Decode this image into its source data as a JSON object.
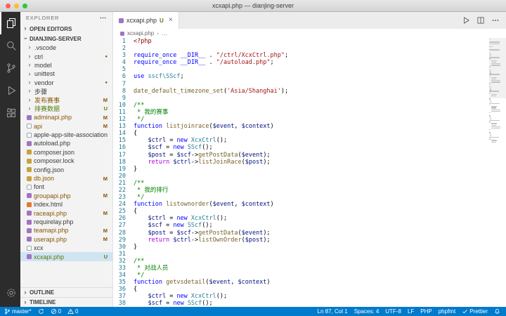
{
  "window": {
    "title": "xcxapi.php — dianjing-server"
  },
  "activity_bar": {
    "items": [
      {
        "name": "explorer",
        "active": true
      },
      {
        "name": "search"
      },
      {
        "name": "source-control"
      },
      {
        "name": "run-debug"
      },
      {
        "name": "extensions"
      },
      {
        "name": "settings",
        "bottom": true
      }
    ]
  },
  "sidebar": {
    "title": "EXPLORER",
    "open_editors_label": "OPEN EDITORS",
    "root_label": "DIANJING-SERVER",
    "outline_label": "OUTLINE",
    "timeline_label": "TIMELINE",
    "tree": [
      {
        "label": ".vscode",
        "kind": "folder",
        "badge": ""
      },
      {
        "label": "ctrl",
        "kind": "folder",
        "badge": "dot"
      },
      {
        "label": "model",
        "kind": "folder",
        "badge": ""
      },
      {
        "label": "unittest",
        "kind": "folder",
        "badge": ""
      },
      {
        "label": "vendor",
        "kind": "folder",
        "badge": "dot"
      },
      {
        "label": "步骤",
        "kind": "folder",
        "badge": ""
      },
      {
        "label": "发布赛事",
        "kind": "folder",
        "badge": "M"
      },
      {
        "label": "排赛数据",
        "kind": "folder",
        "badge": "U"
      },
      {
        "label": "adminapi.php",
        "kind": "php",
        "badge": "M"
      },
      {
        "label": "api",
        "kind": "file",
        "badge": "M"
      },
      {
        "label": "apple-app-site-association",
        "kind": "file",
        "badge": ""
      },
      {
        "label": "autoload.php",
        "kind": "php",
        "badge": ""
      },
      {
        "label": "composer.json",
        "kind": "json",
        "badge": ""
      },
      {
        "label": "composer.lock",
        "kind": "json",
        "badge": ""
      },
      {
        "label": "config.json",
        "kind": "json",
        "badge": ""
      },
      {
        "label": "db.json",
        "kind": "json",
        "badge": "M"
      },
      {
        "label": "font",
        "kind": "file",
        "badge": ""
      },
      {
        "label": "groupapi.php",
        "kind": "php",
        "badge": "M"
      },
      {
        "label": "index.html",
        "kind": "html",
        "badge": ""
      },
      {
        "label": "raceapi.php",
        "kind": "php",
        "badge": "M"
      },
      {
        "label": "requirelay.php",
        "kind": "php",
        "badge": ""
      },
      {
        "label": "teamapi.php",
        "kind": "php",
        "badge": "M"
      },
      {
        "label": "userapi.php",
        "kind": "php",
        "badge": "M"
      },
      {
        "label": "xcx",
        "kind": "file",
        "badge": ""
      },
      {
        "label": "xcxapi.php",
        "kind": "php",
        "badge": "U",
        "selected": true
      }
    ]
  },
  "editor": {
    "tab": {
      "label": "xcxapi.php",
      "badge": "U",
      "close": "×"
    },
    "actions": [
      "run",
      "split",
      "more"
    ],
    "breadcrumb": {
      "file": "xcxapi.php",
      "separator": "›",
      "more": "…"
    },
    "code": [
      [
        [
          "tag",
          "<?php"
        ]
      ],
      [],
      [
        [
          "kw",
          "require_once"
        ],
        [
          "pln",
          " "
        ],
        [
          "kw",
          "__DIR__"
        ],
        [
          "pln",
          " . "
        ],
        [
          "str",
          "\"/ctrl/XcxCtrl.php\""
        ],
        [
          "pln",
          ";"
        ]
      ],
      [
        [
          "kw",
          "require_once"
        ],
        [
          "pln",
          " "
        ],
        [
          "kw",
          "__DIR__"
        ],
        [
          "pln",
          " . "
        ],
        [
          "str",
          "\"/autoload.php\""
        ],
        [
          "pln",
          ";"
        ]
      ],
      [],
      [
        [
          "kw",
          "use"
        ],
        [
          "pln",
          " "
        ],
        [
          "cls",
          "sscf\\SScf"
        ],
        [
          "pln",
          ";"
        ]
      ],
      [],
      [
        [
          "fn",
          "date_default_timezone_set"
        ],
        [
          "pln",
          "("
        ],
        [
          "str",
          "'Asia/Shanghai'"
        ],
        [
          "pln",
          ");"
        ]
      ],
      [],
      [
        [
          "cmt",
          "/**"
        ]
      ],
      [
        [
          "cmt",
          " * 我的赛事"
        ]
      ],
      [
        [
          "cmt",
          " */"
        ]
      ],
      [
        [
          "kw",
          "function"
        ],
        [
          "pln",
          " "
        ],
        [
          "fn",
          "listjoinrace"
        ],
        [
          "pln",
          "("
        ],
        [
          "var",
          "$event"
        ],
        [
          "pln",
          ", "
        ],
        [
          "var",
          "$context"
        ],
        [
          "pln",
          ")"
        ]
      ],
      [
        [
          "pln",
          "{"
        ]
      ],
      [
        [
          "pln",
          "    "
        ],
        [
          "var",
          "$ctrl"
        ],
        [
          "pln",
          " = "
        ],
        [
          "kw",
          "new"
        ],
        [
          "pln",
          " "
        ],
        [
          "cls",
          "XcxCtrl"
        ],
        [
          "pln",
          "();"
        ]
      ],
      [
        [
          "pln",
          "    "
        ],
        [
          "var",
          "$scf"
        ],
        [
          "pln",
          " = "
        ],
        [
          "kw",
          "new"
        ],
        [
          "pln",
          " "
        ],
        [
          "cls",
          "SScf"
        ],
        [
          "pln",
          "();"
        ]
      ],
      [
        [
          "pln",
          "    "
        ],
        [
          "var",
          "$post"
        ],
        [
          "pln",
          " = "
        ],
        [
          "var",
          "$scf"
        ],
        [
          "pln",
          "->"
        ],
        [
          "fn",
          "getPostData"
        ],
        [
          "pln",
          "("
        ],
        [
          "var",
          "$event"
        ],
        [
          "pln",
          ");"
        ]
      ],
      [
        [
          "pln",
          "    "
        ],
        [
          "ctl",
          "return"
        ],
        [
          "pln",
          " "
        ],
        [
          "var",
          "$ctrl"
        ],
        [
          "pln",
          "->"
        ],
        [
          "fn",
          "listJoinRace"
        ],
        [
          "pln",
          "("
        ],
        [
          "var",
          "$post"
        ],
        [
          "pln",
          ");"
        ]
      ],
      [
        [
          "pln",
          "}"
        ]
      ],
      [],
      [
        [
          "cmt",
          "/**"
        ]
      ],
      [
        [
          "cmt",
          " * 我的排行"
        ]
      ],
      [
        [
          "cmt",
          " */"
        ]
      ],
      [
        [
          "kw",
          "function"
        ],
        [
          "pln",
          " "
        ],
        [
          "fn",
          "listownorder"
        ],
        [
          "pln",
          "("
        ],
        [
          "var",
          "$event"
        ],
        [
          "pln",
          ", "
        ],
        [
          "var",
          "$context"
        ],
        [
          "pln",
          ")"
        ]
      ],
      [
        [
          "pln",
          "{"
        ]
      ],
      [
        [
          "pln",
          "    "
        ],
        [
          "var",
          "$ctrl"
        ],
        [
          "pln",
          " = "
        ],
        [
          "kw",
          "new"
        ],
        [
          "pln",
          " "
        ],
        [
          "cls",
          "XcxCtrl"
        ],
        [
          "pln",
          "();"
        ]
      ],
      [
        [
          "pln",
          "    "
        ],
        [
          "var",
          "$scf"
        ],
        [
          "pln",
          " = "
        ],
        [
          "kw",
          "new"
        ],
        [
          "pln",
          " "
        ],
        [
          "cls",
          "SScf"
        ],
        [
          "pln",
          "();"
        ]
      ],
      [
        [
          "pln",
          "    "
        ],
        [
          "var",
          "$post"
        ],
        [
          "pln",
          " = "
        ],
        [
          "var",
          "$scf"
        ],
        [
          "pln",
          "->"
        ],
        [
          "fn",
          "getPostData"
        ],
        [
          "pln",
          "("
        ],
        [
          "var",
          "$event"
        ],
        [
          "pln",
          ");"
        ]
      ],
      [
        [
          "pln",
          "    "
        ],
        [
          "ctl",
          "return"
        ],
        [
          "pln",
          " "
        ],
        [
          "var",
          "$ctrl"
        ],
        [
          "pln",
          "->"
        ],
        [
          "fn",
          "listOwnOrder"
        ],
        [
          "pln",
          "("
        ],
        [
          "var",
          "$post"
        ],
        [
          "pln",
          ");"
        ]
      ],
      [
        [
          "pln",
          "}"
        ]
      ],
      [],
      [
        [
          "cmt",
          "/**"
        ]
      ],
      [
        [
          "cmt",
          " * 对战人员"
        ]
      ],
      [
        [
          "cmt",
          " */"
        ]
      ],
      [
        [
          "kw",
          "function"
        ],
        [
          "pln",
          " "
        ],
        [
          "fn",
          "getvsdetail"
        ],
        [
          "pln",
          "("
        ],
        [
          "var",
          "$event"
        ],
        [
          "pln",
          ", "
        ],
        [
          "var",
          "$context"
        ],
        [
          "pln",
          ")"
        ]
      ],
      [
        [
          "pln",
          "{"
        ]
      ],
      [
        [
          "pln",
          "    "
        ],
        [
          "var",
          "$ctrl"
        ],
        [
          "pln",
          " = "
        ],
        [
          "kw",
          "new"
        ],
        [
          "pln",
          " "
        ],
        [
          "cls",
          "XcxCtrl"
        ],
        [
          "pln",
          "();"
        ]
      ],
      [
        [
          "pln",
          "    "
        ],
        [
          "var",
          "$scf"
        ],
        [
          "pln",
          " = "
        ],
        [
          "kw",
          "new"
        ],
        [
          "pln",
          " "
        ],
        [
          "cls",
          "SScf"
        ],
        [
          "pln",
          "();"
        ]
      ]
    ]
  },
  "status_bar": {
    "left": [
      {
        "name": "git-branch",
        "icon": "branch",
        "label": "master*"
      },
      {
        "name": "sync",
        "icon": "sync",
        "label": ""
      },
      {
        "name": "errors",
        "icon": "error",
        "label": "0"
      },
      {
        "name": "warnings",
        "icon": "warning",
        "label": "0"
      }
    ],
    "right": [
      {
        "name": "cursor-position",
        "label": "Ln 87, Col 1"
      },
      {
        "name": "indentation",
        "label": "Spaces: 4"
      },
      {
        "name": "encoding",
        "label": "UTF-8"
      },
      {
        "name": "eol",
        "label": "LF"
      },
      {
        "name": "language-mode",
        "label": "PHP"
      },
      {
        "name": "phpfmt",
        "label": "phpfmt"
      },
      {
        "name": "prettier",
        "icon": "check",
        "label": "Prettier"
      },
      {
        "name": "notifications",
        "icon": "bell",
        "label": ""
      }
    ]
  },
  "colors": {
    "accent": "#007acc",
    "modified": "#895503",
    "untracked": "#587c0c"
  }
}
